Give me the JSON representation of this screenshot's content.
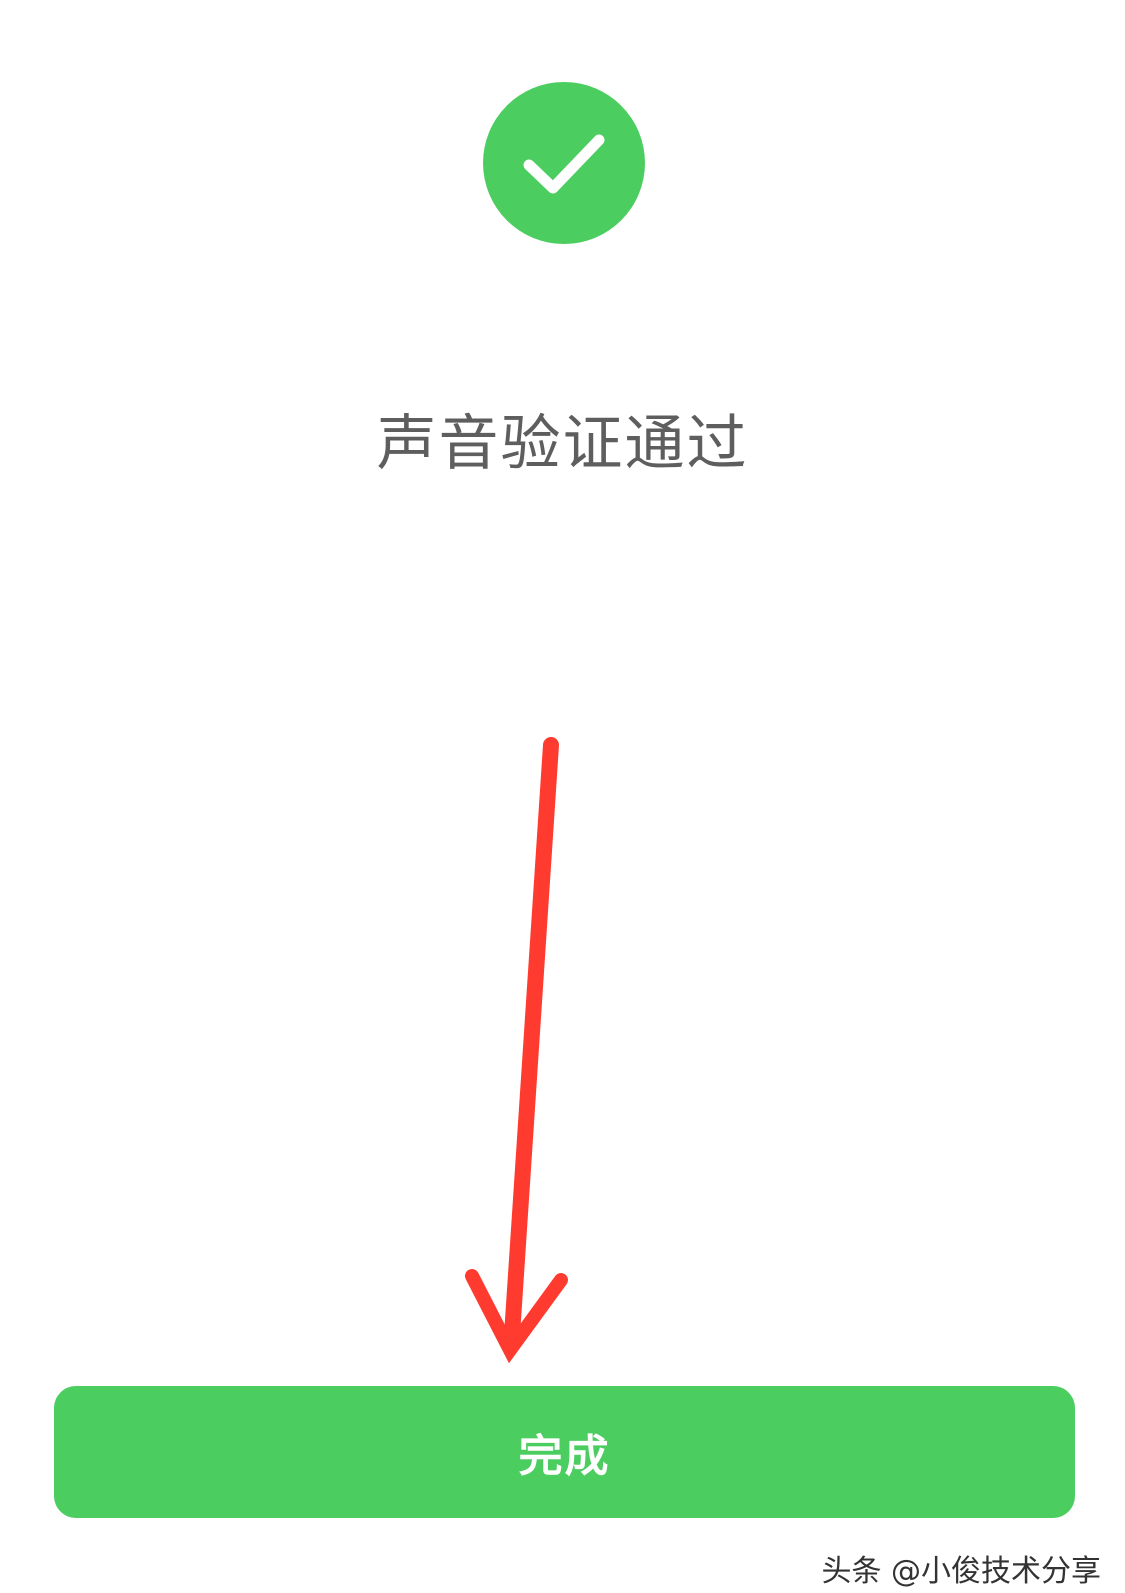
{
  "status": {
    "icon": "checkmark-icon",
    "text": "声音验证通过"
  },
  "done_button": {
    "label": "完成"
  },
  "watermark": {
    "text": "头条 @小俊技术分享"
  },
  "colors": {
    "accent_green": "#4ccd60",
    "arrow_red": "#ff3b30",
    "status_text": "#5e5e5e"
  },
  "annotation": {
    "icon": "arrow-down-icon"
  }
}
